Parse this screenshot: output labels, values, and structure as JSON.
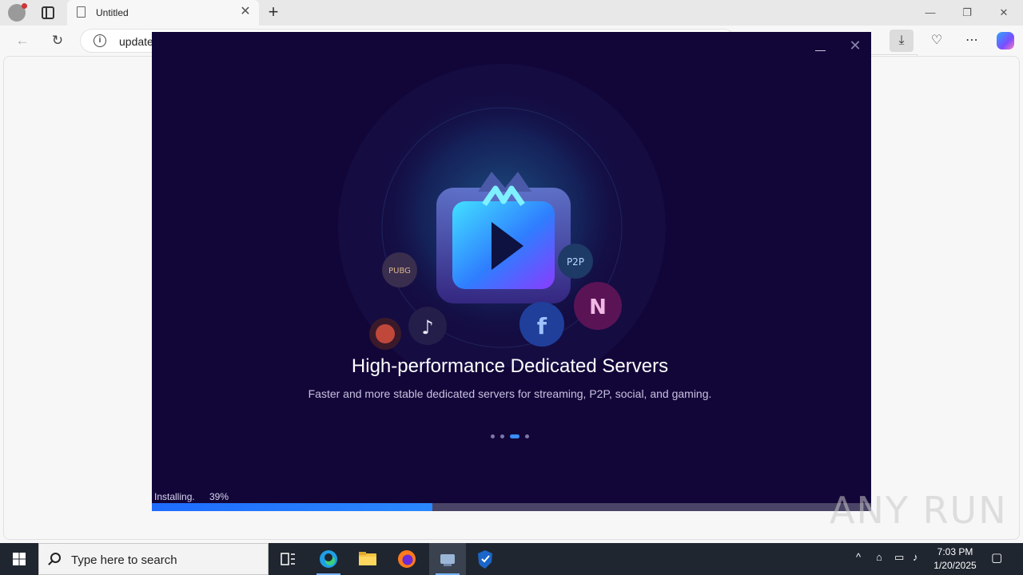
{
  "browser": {
    "tab_title": "Untitled",
    "url_text": "update",
    "tab_close_glyph": "✕",
    "new_tab_glyph": "+"
  },
  "installer": {
    "heading": "High-performance Dedicated Servers",
    "subheading": "Faster and more stable dedicated servers for streaming, P2P, social, and gaming.",
    "status_text": "Installing.",
    "progress_text": "39%",
    "progress_value": 0.39,
    "carousel_active_index": 2,
    "carousel_count": 4,
    "hero_badges": [
      "PUBG",
      "P2P",
      "N",
      "f"
    ],
    "accent_color": "#3a8dff",
    "background_color": "#120639"
  },
  "watermark": "ANY RUN",
  "taskbar": {
    "search_placeholder": "Type here to search",
    "time": "7:03 PM",
    "date": "1/20/2025",
    "apps": [
      "task-view",
      "edge",
      "file-explorer",
      "firefox",
      "installer",
      "security"
    ]
  }
}
